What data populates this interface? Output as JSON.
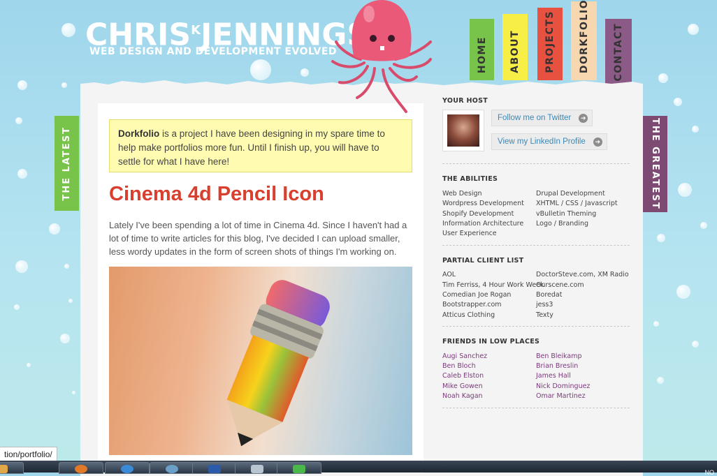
{
  "site": {
    "logo_title": "CHRISKJENNINGS",
    "logo_first": "CHRIS",
    "logo_k": "K",
    "logo_last": "JENNINGS",
    "tagline": "WEB DESIGN AND DEVELOPMENT EVOLVED"
  },
  "nav": [
    {
      "label": "HOME",
      "color": "#78c44a"
    },
    {
      "label": "ABOUT",
      "color": "#f7ef45"
    },
    {
      "label": "PROJECTS",
      "color": "#e8503f"
    },
    {
      "label": "DORKFOLIO",
      "color": "#f6d7b0"
    },
    {
      "label": "CONTACT",
      "color": "#8c5a86"
    }
  ],
  "side_tabs": {
    "left": {
      "label": "THE LATEST",
      "color": "#78c44a"
    },
    "right": {
      "label": "THE GREATEST",
      "color": "#7c4a72"
    }
  },
  "notice": {
    "bold": "Dorkfolio",
    "text": " is a project I have been designing in my spare time to help make portfolios more fun. Until I finish up, you will have to settle for what I have here!"
  },
  "post": {
    "title": "Cinema 4d Pencil Icon",
    "body": "Lately I've been spending a lot of time in Cinema 4d. Since I haven't had a lot of time to write articles for this blog, I've decided I can upload smaller, less wordy updates in the form of screen shots of things I'm working on."
  },
  "sidebar": {
    "host_heading": "YOUR HOST",
    "twitter_label": "Follow me on Twitter",
    "linkedin_label": "View my LinkedIn Profile",
    "abilities_heading": "THE ABILITIES",
    "abilities_col1": [
      "Web Design",
      "Wordpress Development",
      "Shopify Development",
      "Information Architecture",
      "User Experience"
    ],
    "abilities_col2": [
      "Drupal Development",
      "XHTML / CSS / Javascript",
      "vBulletin Theming",
      "Logo / Branding"
    ],
    "clients_heading": "PARTIAL CLIENT LIST",
    "clients_col1": [
      "AOL",
      "Tim Ferriss, 4 Hour Work Week",
      "Comedian Joe Rogan",
      "Bootstrapper.com",
      "Atticus Clothing"
    ],
    "clients_col2": [
      "DoctorSteve.com, XM Radio",
      "Ourscene.com",
      "Boredat",
      "jess3",
      "Texty"
    ],
    "friends_heading": "FRIENDS IN LOW PLACES",
    "friends_col1": [
      "Augi Sanchez",
      "Ben Bloch",
      "Caleb Elston",
      "Mike Gowen",
      "Noah Kagan"
    ],
    "friends_col2": [
      "Ben Bleikamp",
      "Brian Breslin",
      "James Hall",
      "Nick Dominguez",
      "Omar Martinez"
    ]
  },
  "status_url": "tion/portfolio/",
  "tray_text": "NO"
}
